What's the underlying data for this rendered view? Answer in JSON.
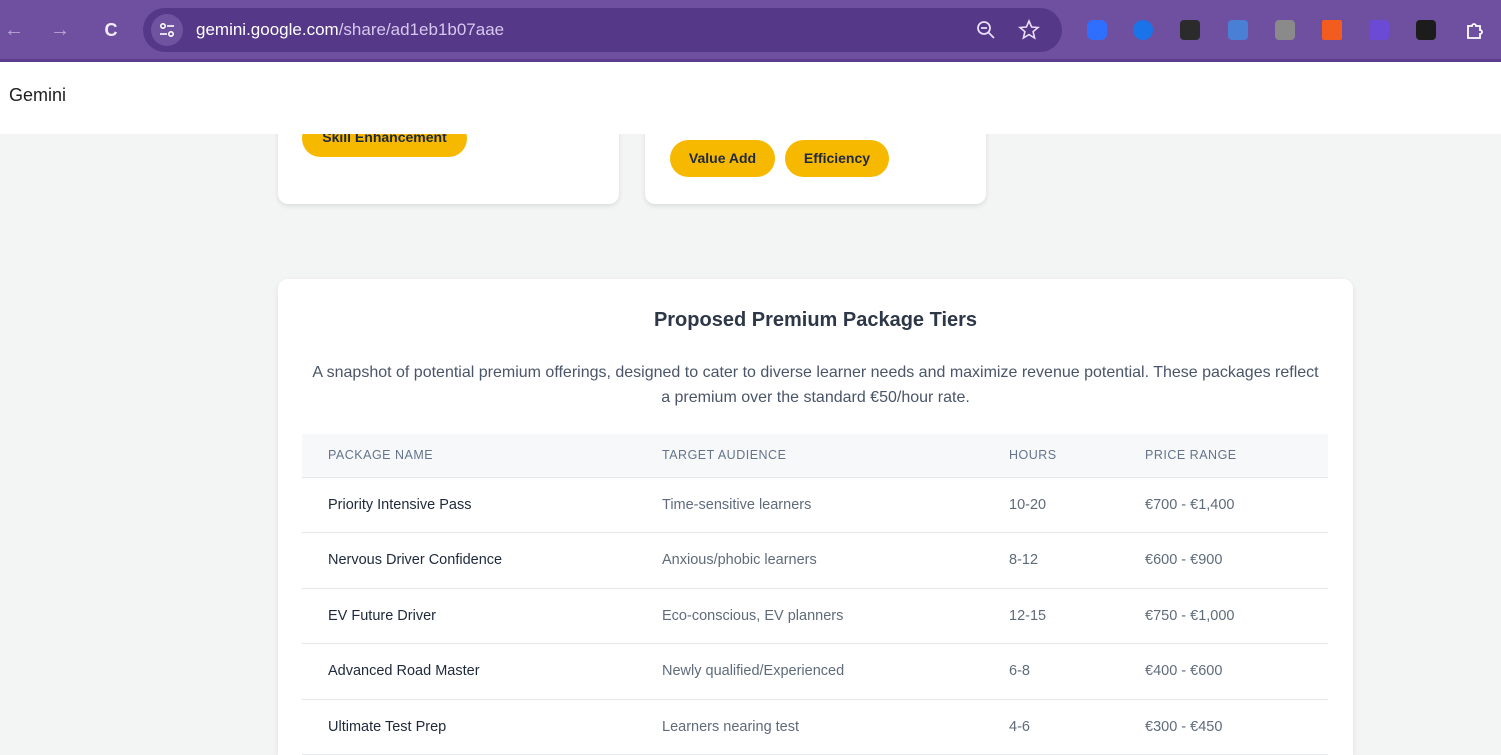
{
  "browser": {
    "url_host": "gemini.google.com",
    "url_path": "/share/ad1eb1b07aae",
    "back_glyph": "←",
    "forward_glyph": "→",
    "reload_glyph": "C",
    "icons": [
      "back-arrow-icon",
      "forward-arrow-icon",
      "reload-icon",
      "site-settings-icon",
      "zoom-out-icon",
      "bookmark-star-icon",
      "extensions-puzzle-icon"
    ],
    "extension_colors": [
      "#2f6fff",
      "#1a73e8",
      "#2b2b2b",
      "#4a7fd6",
      "#8a8a8a",
      "#f25c1f",
      "#6b4bd6",
      "#1c1c1c"
    ],
    "chrome_color": "#6e4fa0"
  },
  "app": {
    "title": "Gemini"
  },
  "cards": {
    "left_tags": [
      "Skill Enhancement"
    ],
    "right_tags": [
      "Value Add",
      "Efficiency"
    ],
    "tag_color": "#f7b900"
  },
  "premium": {
    "title": "Proposed Premium Package Tiers",
    "description": "A snapshot of potential premium offerings, designed to cater to diverse learner needs and maximize revenue potential. These packages reflect a premium over the standard €50/hour rate.",
    "headers": [
      "PACKAGE NAME",
      "TARGET AUDIENCE",
      "HOURS",
      "PRICE RANGE"
    ],
    "rows": [
      [
        "Priority Intensive Pass",
        "Time-sensitive learners",
        "10-20",
        "€700 - €1,400"
      ],
      [
        "Nervous Driver Confidence",
        "Anxious/phobic learners",
        "8-12",
        "€600 - €900"
      ],
      [
        "EV Future Driver",
        "Eco-conscious, EV planners",
        "12-15",
        "€750 - €1,000"
      ],
      [
        "Advanced Road Master",
        "Newly qualified/Experienced",
        "6-8",
        "€400 - €600"
      ],
      [
        "Ultimate Test Prep",
        "Learners nearing test",
        "4-6",
        "€300 - €450"
      ]
    ]
  }
}
